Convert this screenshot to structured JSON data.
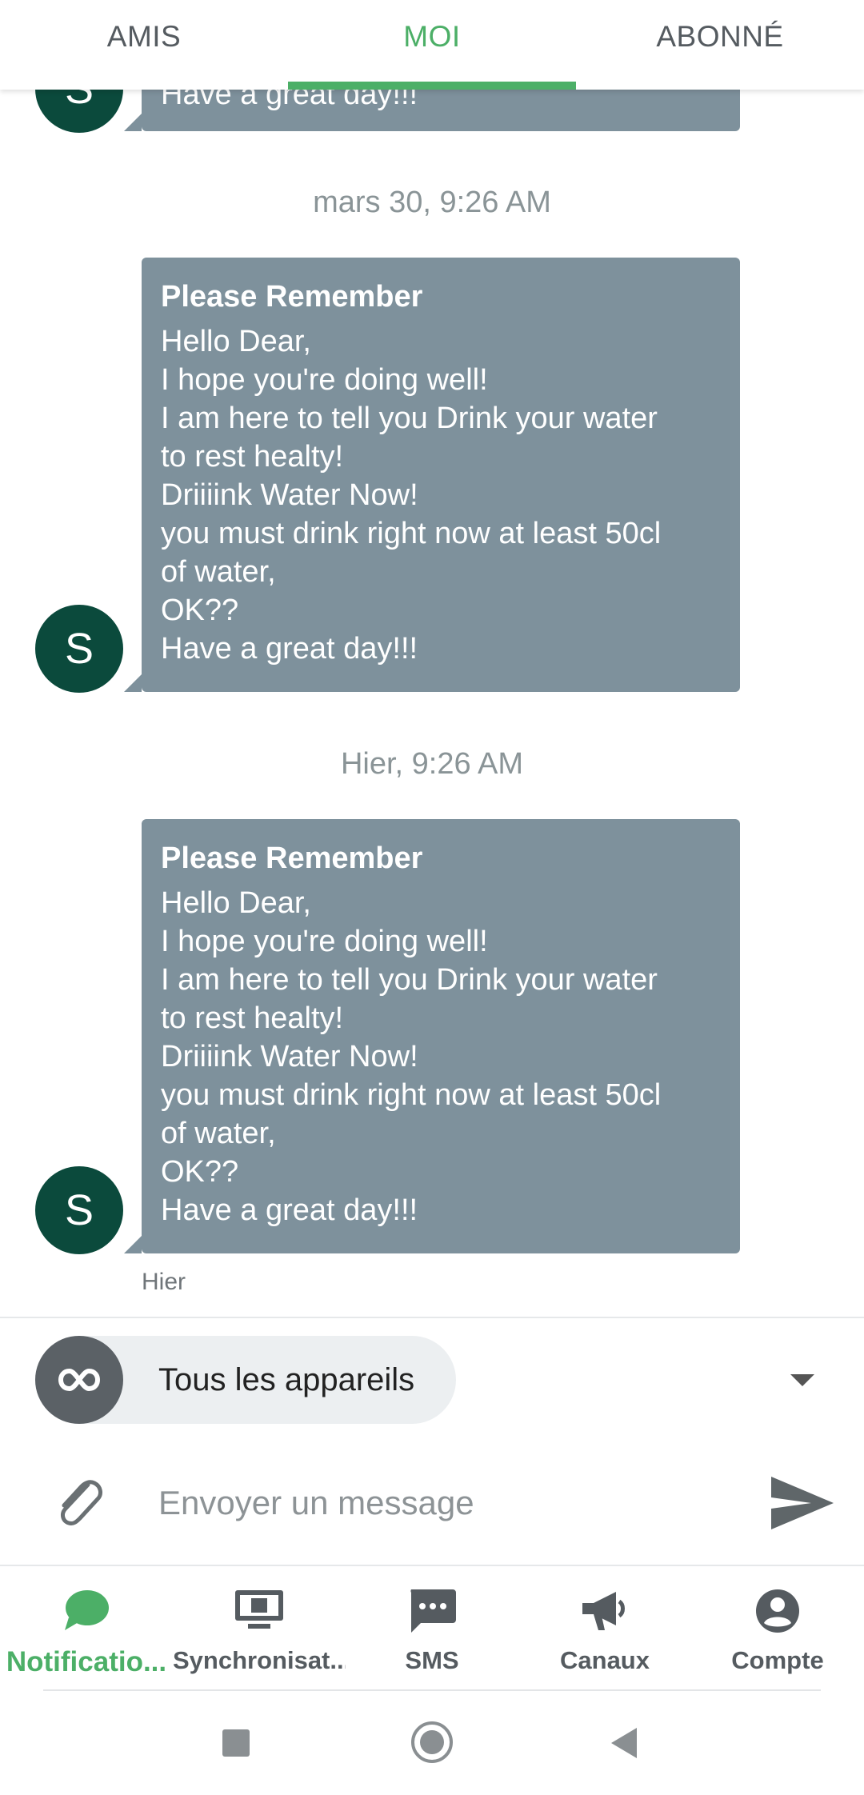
{
  "tabs": [
    {
      "label": "AMIS",
      "active": false
    },
    {
      "label": "MOI",
      "active": true
    },
    {
      "label": "ABONNÉ",
      "active": false
    }
  ],
  "partial_message": {
    "avatar_letter": "S",
    "last_line": "Have a great day!!!"
  },
  "messages": [
    {
      "timestamp": "mars 30, 9:26 AM",
      "avatar_letter": "S",
      "title": "Please Remember",
      "lines": [
        "Hello Dear,",
        "I hope you're doing well!",
        "I am here to tell you Drink your water",
        "to rest healty!",
        "Driiiink Water Now!",
        "you must drink right now at least 50cl",
        "of water,",
        "OK??",
        "Have a great day!!!"
      ]
    },
    {
      "timestamp": "Hier, 9:26 AM",
      "avatar_letter": "S",
      "title": "Please Remember",
      "lines": [
        "Hello Dear,",
        "I hope you're doing well!",
        "I am here to tell you Drink your water",
        "to rest healty!",
        "Driiiink Water Now!",
        "you must drink right now at least 50cl",
        "of water,",
        "OK??",
        "Have a great day!!!"
      ],
      "footer": "Hier"
    }
  ],
  "device_selector": {
    "label": "Tous les appareils",
    "icon": "infinity-icon"
  },
  "compose": {
    "placeholder": "Envoyer un message",
    "attach_icon": "paperclip-icon",
    "send_icon": "send-icon"
  },
  "bottom_nav": [
    {
      "label": "Notificatio...",
      "icon": "chat-bubble-icon",
      "active": true
    },
    {
      "label": "Synchronisat...",
      "icon": "desktop-icon",
      "active": false
    },
    {
      "label": "SMS",
      "icon": "sms-icon",
      "active": false
    },
    {
      "label": "Canaux",
      "icon": "megaphone-icon",
      "active": false
    },
    {
      "label": "Compte",
      "icon": "account-icon",
      "active": false
    }
  ],
  "colors": {
    "accent": "#4caf67",
    "bubble": "#7e919c",
    "avatar": "#0b4a3c"
  }
}
